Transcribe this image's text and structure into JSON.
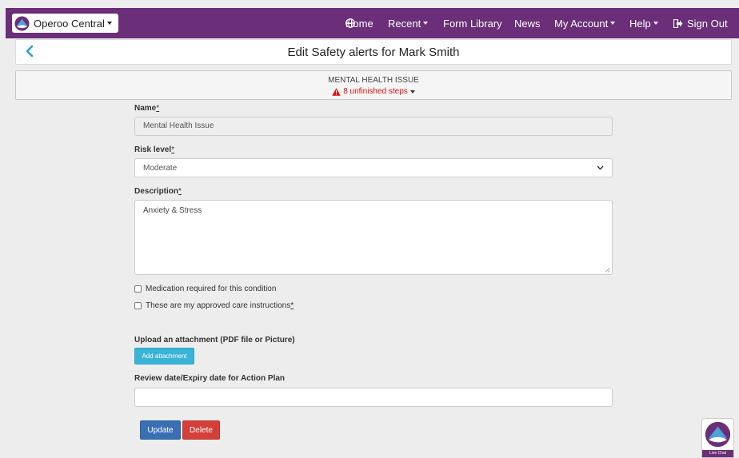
{
  "app": {
    "brand": "Operoo Central"
  },
  "nav": {
    "home": "Home",
    "recent": "Recent",
    "form_library": "Form Library",
    "news": "News",
    "my_account": "My Account",
    "help": "Help",
    "sign_out": "Sign Out"
  },
  "page": {
    "title": "Edit Safety alerts for Mark Smith"
  },
  "steps": {
    "title": "MENTAL HEALTH ISSUE",
    "status": "8 unfinished steps"
  },
  "form": {
    "name_label": "Name",
    "name_value": "Mental Health Issue",
    "risk_label": "Risk level",
    "risk_value": "Moderate",
    "desc_label": "Description",
    "desc_value": "Anxiety & Stress",
    "medication_label": "Medication required for this condition",
    "medication_checked": false,
    "approved_label": "These are my approved care instructions",
    "approved_checked": false,
    "upload_label": "Upload an attachment (PDF file or Picture)",
    "attach_button": "Add attachment",
    "review_label": "Review date/Expiry date for Action Plan",
    "review_value": "",
    "required_marker": "*"
  },
  "actions": {
    "update": "Update",
    "delete": "Delete"
  },
  "livechat": {
    "label": "Live Chat"
  },
  "colors": {
    "nav_bg": "#6b2e78",
    "primary": "#3a6fb4",
    "danger": "#d43f3a",
    "info": "#39b3d7",
    "warning": "#d11"
  }
}
